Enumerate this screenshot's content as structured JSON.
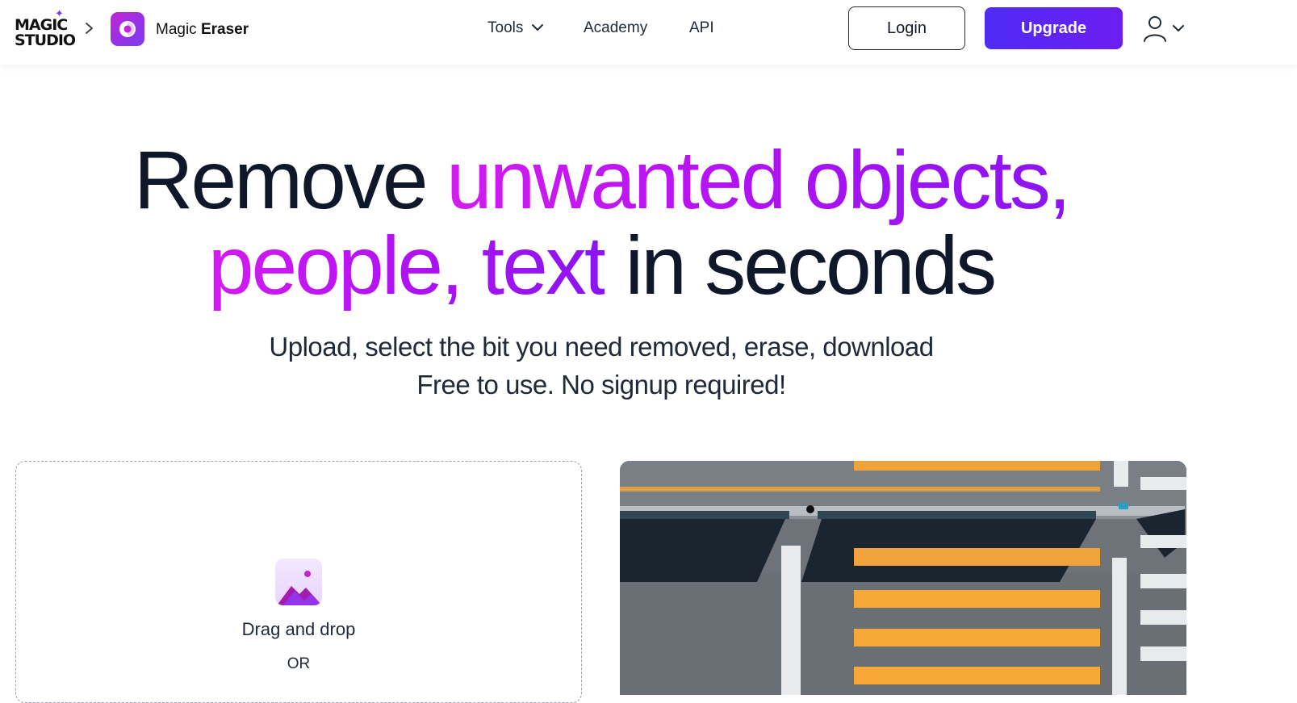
{
  "header": {
    "brand": {
      "line1": "MAGIC",
      "line2": "STUDIO"
    },
    "breadcrumb_separator": "chevron-right-icon",
    "app": {
      "name_regular": "Magic",
      "name_bold": "Eraser",
      "icon": "magic-eraser-icon"
    },
    "nav": {
      "tools_label": "Tools",
      "academy_label": "Academy",
      "api_label": "API"
    },
    "login_label": "Login",
    "upgrade_label": "Upgrade",
    "user_icon": "user-icon"
  },
  "hero": {
    "line1_plain": "Remove ",
    "line1_highlight": "unwanted objects,",
    "line2_highlight": "people, text",
    "line2_plain": " in seconds",
    "subtitle_1": "Upload, select the bit you need removed, erase, download",
    "subtitle_2": "Free to use. No signup required!"
  },
  "upload": {
    "icon": "image-upload-icon",
    "drag_label": "Drag and drop",
    "or_label": "OR"
  },
  "preview": {
    "description_icon": "crosswalk-example-image"
  },
  "colors": {
    "accent_gradient_start": "#d41cf0",
    "accent_gradient_end": "#8a15f2",
    "upgrade_button": "#5a25f3",
    "text_dark": "#0f172a"
  }
}
